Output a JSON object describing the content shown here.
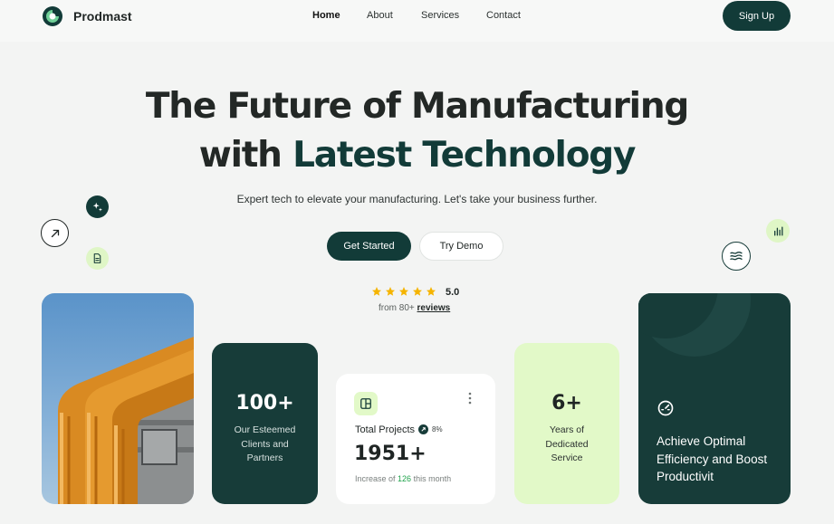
{
  "header": {
    "brand": "Prodmast",
    "nav": [
      "Home",
      "About",
      "Services",
      "Contact"
    ],
    "signup_label": "Sign Up"
  },
  "hero": {
    "title_line1": "The Future of Manufacturing",
    "title_line2_prefix": "with ",
    "title_line2_accent": "Latest Technology",
    "subtitle": "Expert tech to elevate your manufacturing. Let's take your business further.",
    "get_started_label": "Get Started",
    "try_demo_label": "Try Demo",
    "rating": "5.0",
    "reviews_prefix": "from 80+ ",
    "reviews_link": "reviews"
  },
  "cards": {
    "clients": {
      "number": "100+",
      "label": "Our Esteemed Clients and Partners"
    },
    "projects": {
      "title": "Total Projects",
      "change": "8%",
      "number": "1951+",
      "increase_prefix": "Increase of ",
      "increase_value": "126",
      "increase_suffix": " this month"
    },
    "years": {
      "number": "6+",
      "label": "Years of Dedicated Service"
    },
    "efficiency": {
      "text": "Achieve Optimal Efficiency and Boost Productivit"
    }
  },
  "colors": {
    "brand_dark": "#123b38",
    "lime": "#e2f9c8",
    "star": "#f5b400",
    "increase_green": "#1ea34a"
  },
  "icons": [
    "logo-icon",
    "sparkle-icon",
    "arrow-up-right-icon",
    "document-icon",
    "bar-chart-icon",
    "waves-icon",
    "layout-icon",
    "trend-up-icon",
    "kebab-menu-icon",
    "gauge-icon",
    "star-icon"
  ]
}
